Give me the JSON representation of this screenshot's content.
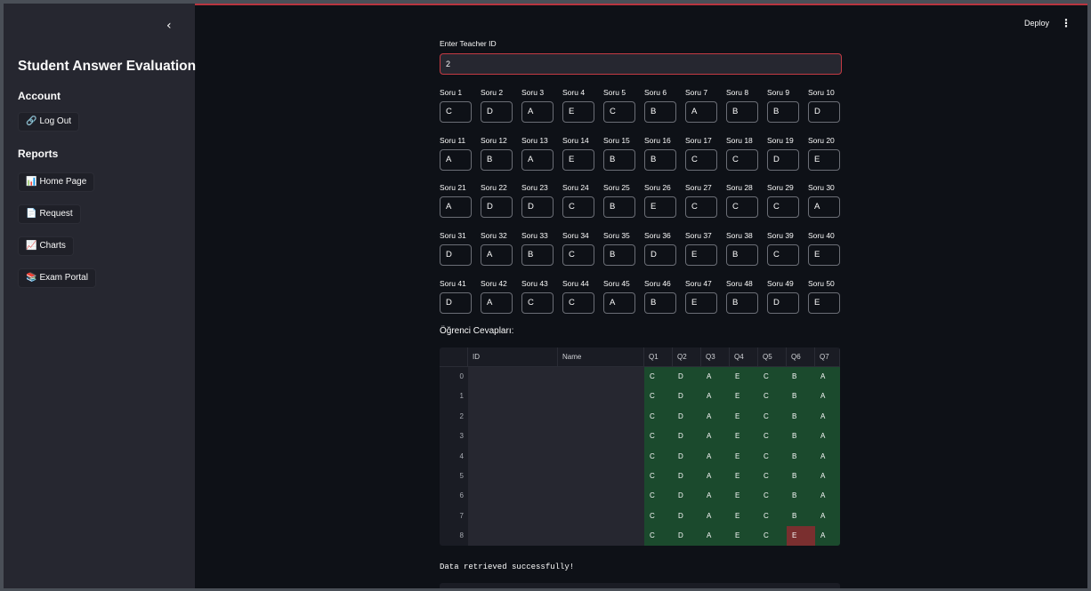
{
  "header": {
    "deploy_label": "Deploy",
    "menu_icon": "⋮"
  },
  "sidebar": {
    "collapse_icon": "‹",
    "title": "Student Answer Evaluation",
    "account_heading": "Account",
    "logout": {
      "icon": "🔗",
      "label": "Log Out"
    },
    "reports_heading": "Reports",
    "items": [
      {
        "icon": "📊",
        "label": "Home Page"
      },
      {
        "icon": "📄",
        "label": "Request"
      },
      {
        "icon": "📈",
        "label": "Charts"
      },
      {
        "icon": "📚",
        "label": "Exam Portal"
      }
    ]
  },
  "teacher": {
    "label": "Enter Teacher ID",
    "value": "2"
  },
  "answers": {
    "labels": [
      "Soru 1",
      "Soru 2",
      "Soru 3",
      "Soru 4",
      "Soru 5",
      "Soru 6",
      "Soru 7",
      "Soru 8",
      "Soru 9",
      "Soru 10",
      "Soru 11",
      "Soru 12",
      "Soru 13",
      "Soru 14",
      "Soru 15",
      "Soru 16",
      "Soru 17",
      "Soru 18",
      "Soru 19",
      "Soru 20",
      "Soru 21",
      "Soru 22",
      "Soru 23",
      "Soru 24",
      "Soru 25",
      "Soru 26",
      "Soru 27",
      "Soru 28",
      "Soru 29",
      "Soru 30",
      "Soru 31",
      "Soru 32",
      "Soru 33",
      "Soru 34",
      "Soru 35",
      "Soru 36",
      "Soru 37",
      "Soru 38",
      "Soru 39",
      "Soru 40",
      "Soru 41",
      "Soru 42",
      "Soru 43",
      "Soru 44",
      "Soru 45",
      "Soru 46",
      "Soru 47",
      "Soru 48",
      "Soru 49",
      "Soru 50"
    ],
    "values": [
      "C",
      "D",
      "A",
      "E",
      "C",
      "B",
      "A",
      "B",
      "B",
      "D",
      "A",
      "B",
      "A",
      "E",
      "B",
      "B",
      "C",
      "C",
      "D",
      "E",
      "A",
      "D",
      "D",
      "C",
      "B",
      "E",
      "C",
      "C",
      "C",
      "A",
      "D",
      "A",
      "B",
      "C",
      "B",
      "D",
      "E",
      "B",
      "C",
      "E",
      "D",
      "A",
      "C",
      "C",
      "A",
      "B",
      "E",
      "B",
      "D",
      "E"
    ]
  },
  "student_section_label": "Öğrenci Cevapları:",
  "student_table": {
    "columns": [
      "",
      "ID",
      "Name",
      "Q1",
      "Q2",
      "Q3",
      "Q4",
      "Q5",
      "Q6",
      "Q7"
    ],
    "rows": [
      {
        "index": "0",
        "answers": [
          "C",
          "D",
          "A",
          "E",
          "C",
          "B",
          "A"
        ],
        "status": [
          "ok",
          "ok",
          "ok",
          "ok",
          "ok",
          "ok",
          "ok"
        ]
      },
      {
        "index": "1",
        "answers": [
          "C",
          "D",
          "A",
          "E",
          "C",
          "B",
          "A"
        ],
        "status": [
          "ok",
          "ok",
          "ok",
          "ok",
          "ok",
          "ok",
          "ok"
        ]
      },
      {
        "index": "2",
        "answers": [
          "C",
          "D",
          "A",
          "E",
          "C",
          "B",
          "A"
        ],
        "status": [
          "ok",
          "ok",
          "ok",
          "ok",
          "ok",
          "ok",
          "ok"
        ]
      },
      {
        "index": "3",
        "answers": [
          "C",
          "D",
          "A",
          "E",
          "C",
          "B",
          "A"
        ],
        "status": [
          "ok",
          "ok",
          "ok",
          "ok",
          "ok",
          "ok",
          "ok"
        ]
      },
      {
        "index": "4",
        "answers": [
          "C",
          "D",
          "A",
          "E",
          "C",
          "B",
          "A"
        ],
        "status": [
          "ok",
          "ok",
          "ok",
          "ok",
          "ok",
          "ok",
          "ok"
        ]
      },
      {
        "index": "5",
        "answers": [
          "C",
          "D",
          "A",
          "E",
          "C",
          "B",
          "A"
        ],
        "status": [
          "ok",
          "ok",
          "ok",
          "ok",
          "ok",
          "ok",
          "ok"
        ]
      },
      {
        "index": "6",
        "answers": [
          "C",
          "D",
          "A",
          "E",
          "C",
          "B",
          "A"
        ],
        "status": [
          "ok",
          "ok",
          "ok",
          "ok",
          "ok",
          "ok",
          "ok"
        ]
      },
      {
        "index": "7",
        "answers": [
          "C",
          "D",
          "A",
          "E",
          "C",
          "B",
          "A"
        ],
        "status": [
          "ok",
          "ok",
          "ok",
          "ok",
          "ok",
          "ok",
          "ok"
        ]
      },
      {
        "index": "8",
        "answers": [
          "C",
          "D",
          "A",
          "E",
          "C",
          "E",
          "A"
        ],
        "status": [
          "ok",
          "ok",
          "ok",
          "ok",
          "ok",
          "wrong",
          "ok"
        ]
      }
    ],
    "colors": {
      "correct": "#1b4a2d",
      "wrong": "#7a2f2f"
    }
  },
  "status_message": "Data retrieved successfully!"
}
